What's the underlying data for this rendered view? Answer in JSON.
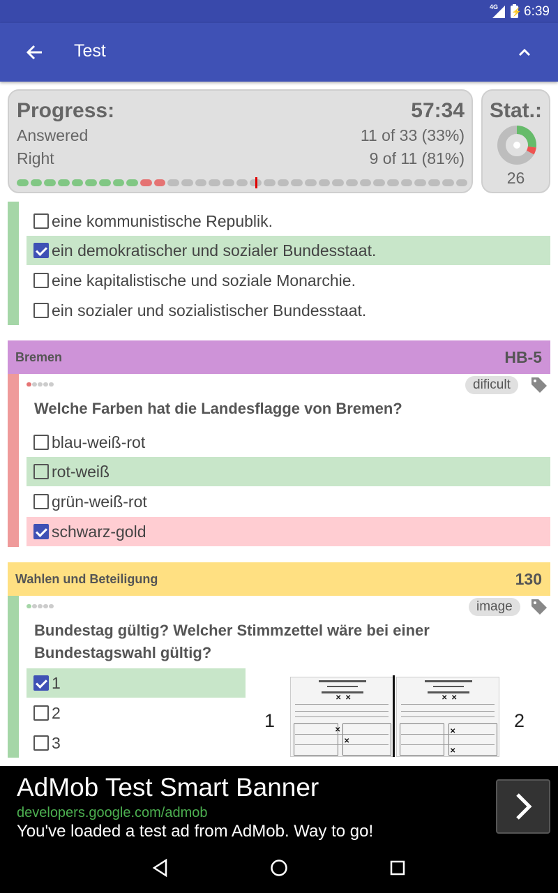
{
  "status_bar": {
    "network": "4G",
    "time": "6:39"
  },
  "app_bar": {
    "title": "Test",
    "back_icon": "arrow-back-icon",
    "collapse_icon": "chevron-up-icon"
  },
  "progress": {
    "title": "Progress:",
    "timer": "57:34",
    "answered_label": "Answered",
    "answered_value": "11 of 33 (33%)",
    "right_label": "Right",
    "right_value": "9 of 11 (81%)",
    "segments": [
      "right",
      "right",
      "right",
      "right",
      "right",
      "right",
      "right",
      "right",
      "right",
      "wrong",
      "wrong",
      "none",
      "none",
      "none",
      "none",
      "none",
      "none",
      "current",
      "none",
      "none",
      "none",
      "none",
      "none",
      "none",
      "none",
      "none",
      "none",
      "none",
      "none",
      "none",
      "none",
      "none",
      "none"
    ]
  },
  "stat": {
    "title": "Stat.:",
    "value": "26",
    "right_fraction": 0.27,
    "wrong_fraction": 0.06
  },
  "question1": {
    "options": [
      {
        "label": "eine kommunistische Republik.",
        "checked": false,
        "state": "none"
      },
      {
        "label": "ein demokratischer und sozialer Bundesstaat.",
        "checked": true,
        "state": "right"
      },
      {
        "label": "eine kapitalistische und soziale Monarchie.",
        "checked": false,
        "state": "none"
      },
      {
        "label": "ein sozialer und sozialistischer Bundesstaat.",
        "checked": false,
        "state": "none"
      }
    ]
  },
  "question2": {
    "category": "Bremen",
    "id": "HB-5",
    "tag": "dificult",
    "question": "Welche Farben hat die Landesflagge von Bremen?",
    "options": [
      {
        "label": "blau-weiß-rot",
        "checked": false,
        "state": "none"
      },
      {
        "label": "rot-weiß",
        "checked": false,
        "state": "right"
      },
      {
        "label": "grün-weiß-rot",
        "checked": false,
        "state": "none"
      },
      {
        "label": "schwarz-gold",
        "checked": true,
        "state": "wrong"
      }
    ]
  },
  "question3": {
    "category": "Wahlen und Beteiligung",
    "id": "130",
    "tag": "image",
    "question": "Bundestag gültig? Welcher Stimmzettel wäre bei einer Bundestagswahl gültig?",
    "options": [
      {
        "label": "1",
        "checked": true,
        "state": "right"
      },
      {
        "label": "2",
        "checked": false,
        "state": "none"
      },
      {
        "label": "3",
        "checked": false,
        "state": "none"
      }
    ],
    "image_labels": [
      "1",
      "2"
    ]
  },
  "ad": {
    "title": "AdMob Test Smart Banner",
    "url": "developers.google.com/admob",
    "text": "You've loaded a test ad from AdMob. Way to go!",
    "button_icon": "chevron-right-icon"
  },
  "colors": {
    "appbar": "#3f51b5",
    "right": "#c8e6c9",
    "wrong": "#ffcdd2",
    "cat_bremen": "#ce93d8",
    "cat_wahlen": "#ffe082",
    "bar_green": "#a5d6a7",
    "bar_red": "#ef9a9a"
  }
}
